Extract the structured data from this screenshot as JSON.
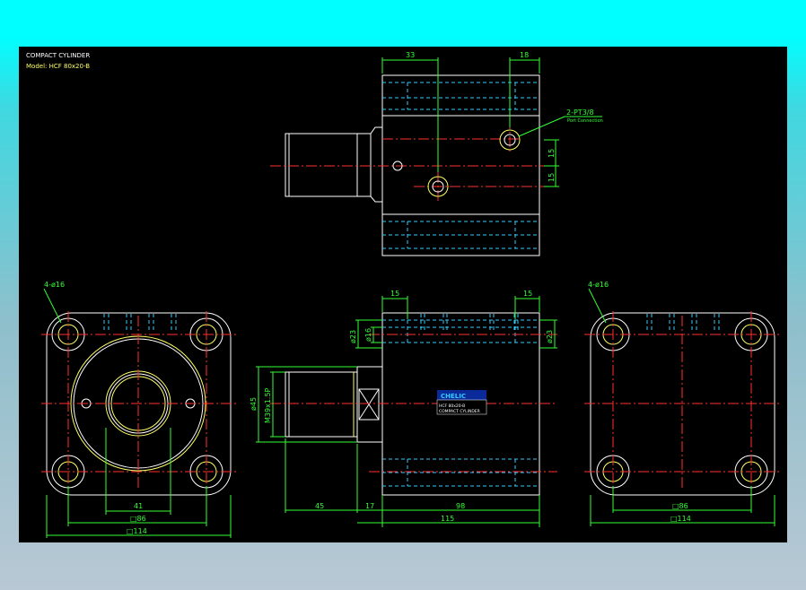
{
  "drawing": {
    "title": "COMPACT CYLINDER",
    "model": "Model: HCF 80x20-B",
    "colors": {
      "page": "#000000",
      "outline": "#ffffff",
      "dimension": "#33ff33",
      "hidden": "#33ccff",
      "center": "#ff3030",
      "thread": "#ffff66"
    }
  },
  "top_view": {
    "dim_33": "33",
    "dim_18": "18",
    "dim_15a": "15",
    "dim_15b": "15",
    "port_label": "2-PT3/8",
    "port_sub": "Port Connection"
  },
  "left_view": {
    "holes": "4-ø16",
    "dim_41": "41",
    "dim_86": "□86",
    "dim_114": "□114"
  },
  "front_view": {
    "dim_15l": "15",
    "dim_15r": "15",
    "dia_23l": "ø23",
    "dia_16": "ø16",
    "dia_23r": "ø23",
    "dia_45": "ø45",
    "thread": "M39x1.5P",
    "dim_45": "45",
    "dim_17": "17",
    "dim_98": "98",
    "dim_115": "115",
    "nameplate_brand": "CHELIC",
    "nameplate_line1": "HCF 80x20-B",
    "nameplate_line2": "COMPACT CYLINDER"
  },
  "right_view": {
    "holes": "4-ø16",
    "dim_86": "□86",
    "dim_114": "□114"
  }
}
